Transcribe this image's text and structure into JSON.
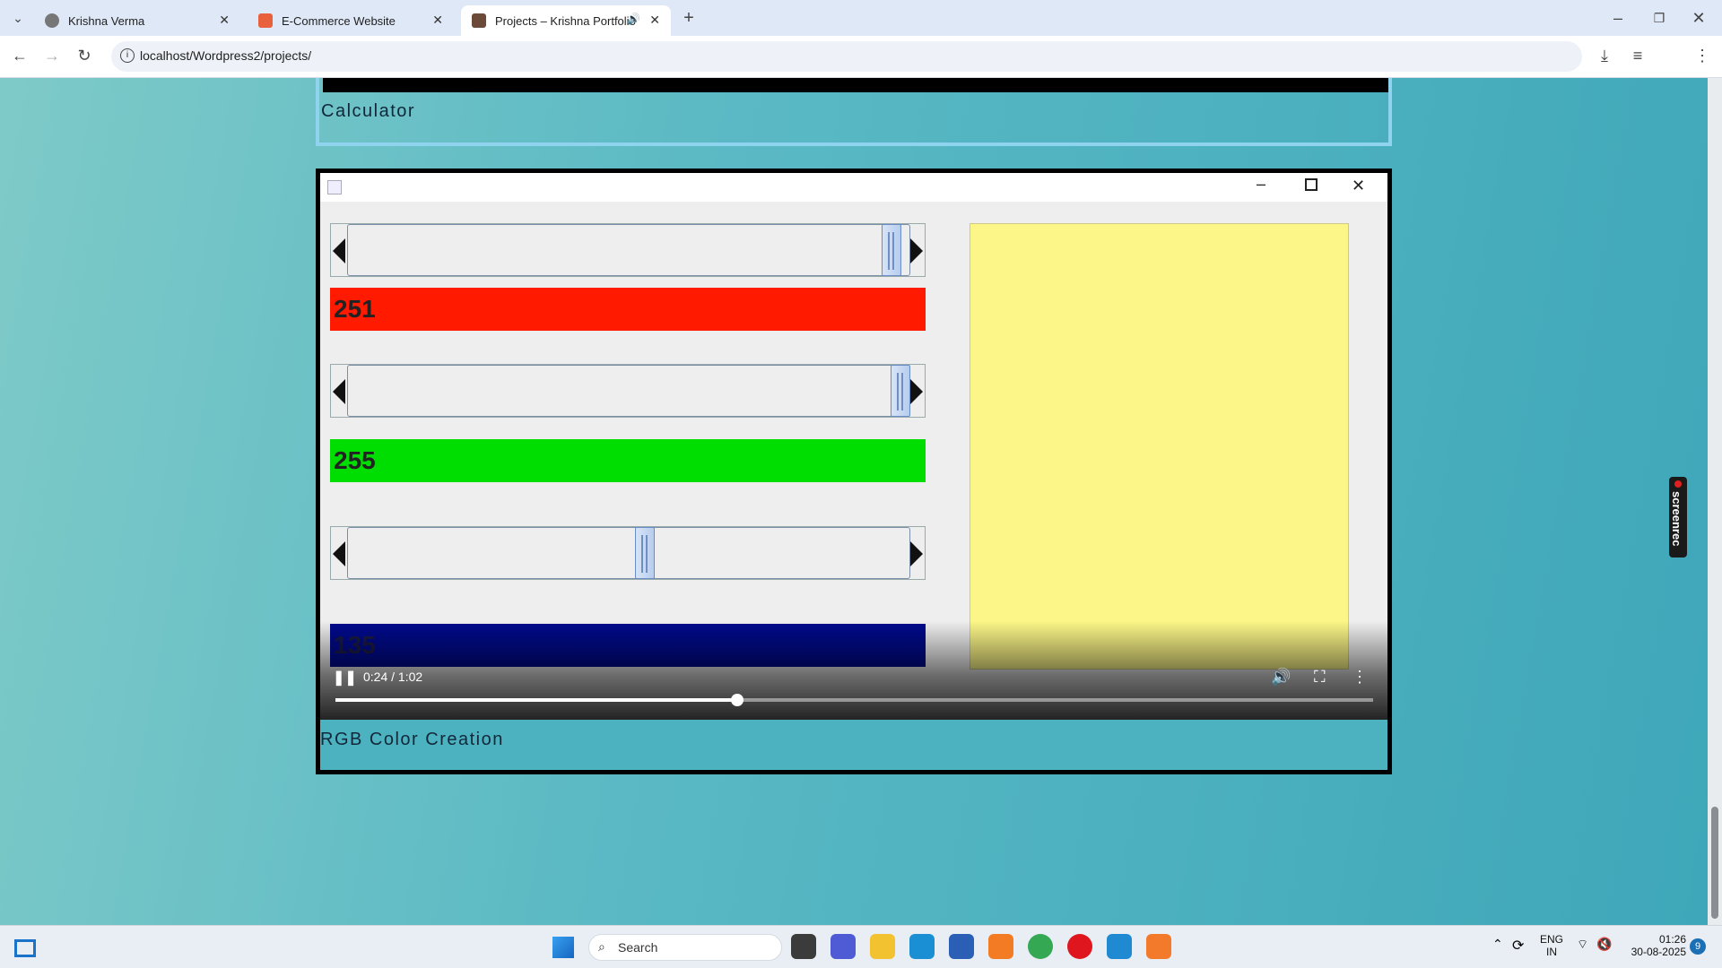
{
  "browser": {
    "tabs": [
      {
        "title": "Krishna Verma",
        "icon": "globe-icon",
        "active": false
      },
      {
        "title": "E-Commerce Website",
        "icon": "xampp-icon",
        "active": false
      },
      {
        "title": "Projects – Krishna Portfolio",
        "icon": "avatar-icon",
        "active": true,
        "audio": true
      }
    ],
    "url": "localhost/Wordpress2/projects/"
  },
  "page": {
    "card1_caption": "Calculator",
    "card2_caption": "RGB Color Creation"
  },
  "video": {
    "time": "0:24 / 1:02",
    "progress": 0.387,
    "app": {
      "red_value": "251",
      "green_value": "255",
      "blue_value": "135",
      "red_slider": 0.984,
      "green_slider": 1.0,
      "blue_slider": 0.529,
      "preview_color": "#fbf687",
      "bar_colors": {
        "red": "#ff1a00",
        "green": "#00dd00",
        "blue": "#000a8c"
      }
    }
  },
  "overlay": {
    "screenrec_label": "screenrec"
  },
  "taskbar": {
    "search_placeholder": "Search",
    "language": "ENG",
    "region": "IN",
    "time": "01:26",
    "date": "30-08-2025",
    "notification_count": "9"
  }
}
